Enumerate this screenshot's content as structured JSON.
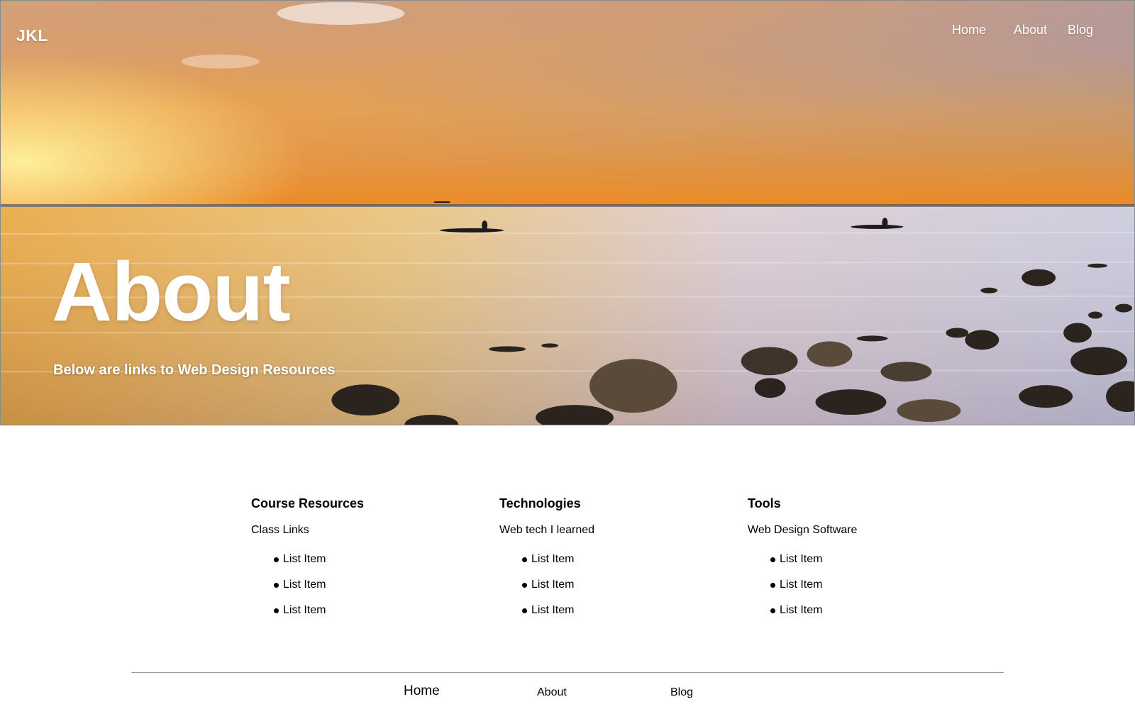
{
  "brand": "JKL",
  "nav": [
    {
      "label": "Home"
    },
    {
      "label": "About"
    },
    {
      "label": "Blog"
    }
  ],
  "hero": {
    "title": "About",
    "subtitle": "Below are links to Web Design Resources"
  },
  "columns": [
    {
      "heading": "Course Resources",
      "subheading": "Class Links",
      "items": [
        "List Item",
        "List Item",
        "List Item"
      ]
    },
    {
      "heading": "Technologies",
      "subheading": "Web tech I learned",
      "items": [
        "List Item",
        "List Item",
        "List Item"
      ]
    },
    {
      "heading": "Tools",
      "subheading": "Web Design Software",
      "items": [
        "List Item",
        "List Item",
        "List Item"
      ]
    }
  ],
  "footer_nav": [
    {
      "label": "Home"
    },
    {
      "label": "About"
    },
    {
      "label": "Blog"
    }
  ],
  "colors": {
    "text_on_image": "#ffffff",
    "body_text": "#000000",
    "footer_rule": "#9a9a9a",
    "sky_top": "#7b85b6",
    "sunset_orange": "#f2a23a",
    "water": "#d9c9c9"
  },
  "icons": {
    "list_bullet": "bullet-dot-icon"
  }
}
